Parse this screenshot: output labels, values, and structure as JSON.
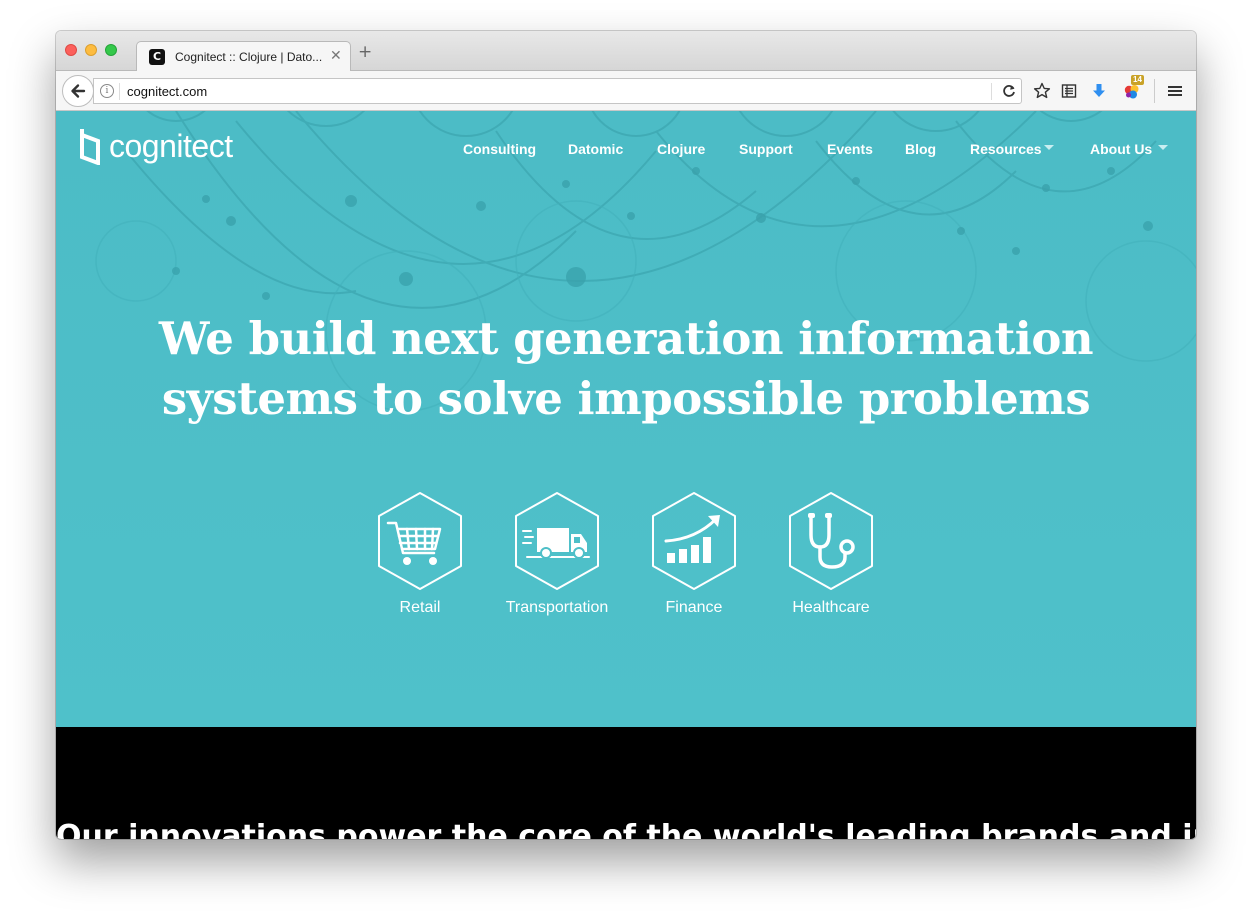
{
  "browser": {
    "tab_title": "Cognitect :: Clojure | Dato...",
    "tab_favicon_glyph": "C",
    "url": "cognitect.com",
    "ext_badge": "14",
    "icons": [
      "back-arrow-icon",
      "info-icon",
      "reload-icon",
      "star-icon",
      "reading-list-icon",
      "download-icon",
      "extension-icon",
      "hamburger-menu-icon"
    ]
  },
  "site": {
    "logo_text": "cognitect",
    "nav": [
      "Consulting",
      "Datomic",
      "Clojure",
      "Support",
      "Events",
      "Blog",
      "Resources",
      "About Us"
    ],
    "headline_line1": "We build next generation information",
    "headline_line2": "systems to solve impossible problems",
    "industries": [
      {
        "label": "Retail",
        "icon": "shopping-cart-icon"
      },
      {
        "label": "Transportation",
        "icon": "truck-icon"
      },
      {
        "label": "Finance",
        "icon": "growth-chart-icon"
      },
      {
        "label": "Healthcare",
        "icon": "stethoscope-icon"
      }
    ],
    "band_title": "Our innovations power the core of the world's leading brands and industries"
  },
  "colors": {
    "hero_bg": "#4ebfc8",
    "band_bg": "#000000",
    "text": "#ffffff"
  }
}
